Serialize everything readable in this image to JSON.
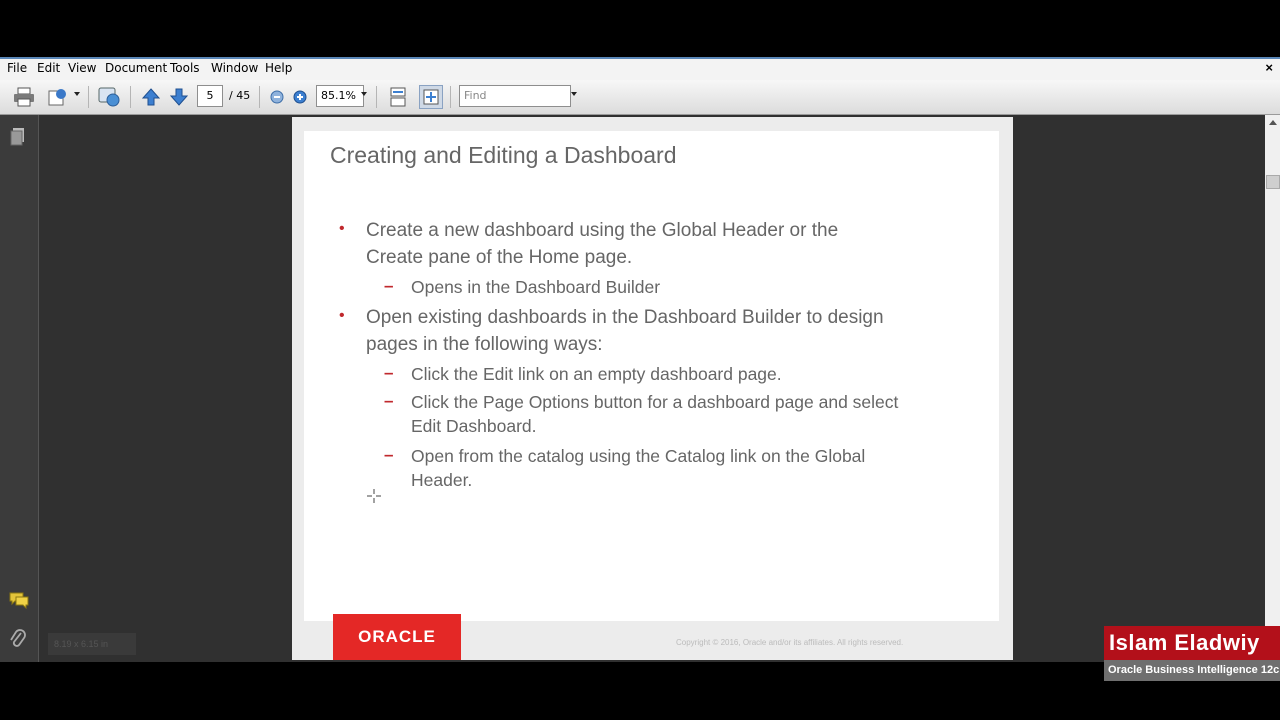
{
  "menu": [
    "File",
    "Edit",
    "View",
    "Document",
    "Tools",
    "Window",
    "Help"
  ],
  "toolbar": {
    "page_current": "5",
    "page_total": "/ 45",
    "zoom": "85.1%",
    "find_placeholder": "Find"
  },
  "slide": {
    "title": "Creating and Editing a Dashboard",
    "bullet1_line1": "Create a new dashboard using the Global Header or the",
    "bullet1_line2": "Create pane of the Home page.",
    "bullet1_sub1": "Opens in the Dashboard Builder",
    "bullet2_line1": "Open existing dashboards in the Dashboard Builder to design",
    "bullet2_line2": "pages in the following ways:",
    "bullet2_sub1": "Click the Edit link on an empty dashboard page.",
    "bullet2_sub2_line1": "Click the Page Options button for a dashboard page and select",
    "bullet2_sub2_line2": "Edit Dashboard.",
    "bullet2_sub3_line1": "Open from the catalog using the Catalog link on the Global",
    "bullet2_sub3_line2": "Header.",
    "logo_text": "ORACLE",
    "copyright": "Copyright © 2016, Oracle and/or its affiliates. All rights reserved."
  },
  "status": {
    "page_size": "8.19 x 6.15 in"
  },
  "watermark": {
    "name": "Islam Eladwiy",
    "subtitle": "Oracle Business Intelligence 12c"
  },
  "colors": {
    "accent_red": "#c0282d",
    "oracle_red": "#e42826",
    "brand_red": "#b3101a"
  }
}
